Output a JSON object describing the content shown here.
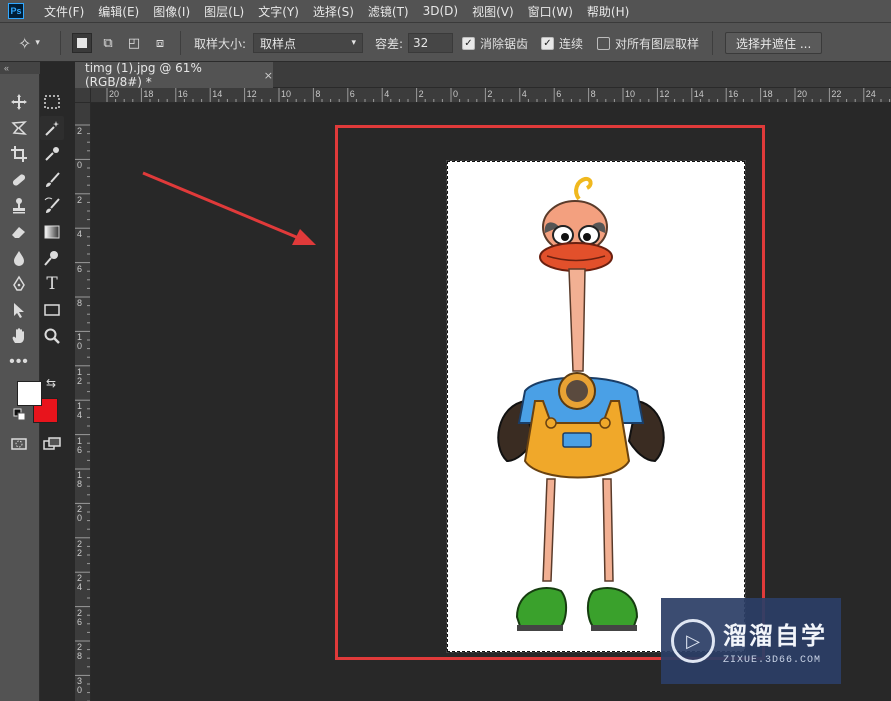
{
  "app": {
    "logo": "Ps"
  },
  "menu": [
    "文件(F)",
    "编辑(E)",
    "图像(I)",
    "图层(L)",
    "文字(Y)",
    "选择(S)",
    "滤镜(T)",
    "3D(D)",
    "视图(V)",
    "窗口(W)",
    "帮助(H)"
  ],
  "options": {
    "sample_size_label": "取样大小:",
    "sample_size_value": "取样点",
    "tolerance_label": "容差:",
    "tolerance_value": "32",
    "antialias_label": "消除锯齿",
    "antialias_checked": true,
    "contiguous_label": "连续",
    "contiguous_checked": true,
    "sample_all_layers_label": "对所有图层取样",
    "sample_all_layers_checked": false,
    "select_and_mask_label": "选择并遮住 ..."
  },
  "document": {
    "tab_title": "timg (1).jpg @ 61%(RGB/8#) *",
    "close_glyph": "×"
  },
  "rulers": {
    "horizontal": [
      "20",
      "18",
      "16",
      "14",
      "12",
      "10",
      "8",
      "6",
      "4",
      "2",
      "0",
      "2",
      "4",
      "6",
      "8",
      "10",
      "12",
      "14",
      "16",
      "18",
      "20",
      "22",
      "24"
    ],
    "vertical": [
      "2",
      "0",
      "2",
      "4",
      "6",
      "8",
      "10",
      "12",
      "14",
      "16",
      "18",
      "20",
      "22",
      "24",
      "26",
      "28",
      "30"
    ]
  },
  "colors": {
    "foreground": "#ffffff",
    "background": "#e8141c",
    "highlight": "#e03a3a",
    "arrow": "#e03a3a"
  },
  "watermark": {
    "title": "溜溜自学",
    "subtitle": "ZIXUE.3D66.COM"
  }
}
